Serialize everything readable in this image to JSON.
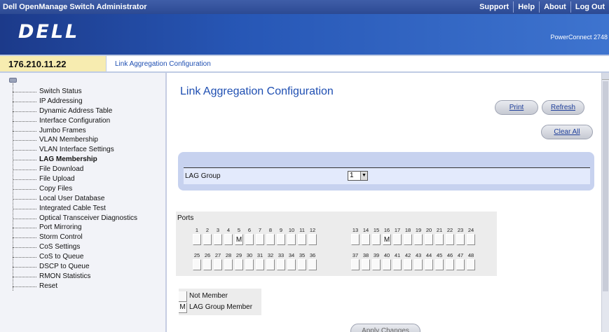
{
  "topbar": {
    "title": "Dell OpenManage Switch Administrator",
    "links": [
      "Support",
      "Help",
      "About",
      "Log Out"
    ]
  },
  "banner": {
    "logo": "DELL",
    "product": "PowerConnect 2748"
  },
  "address": {
    "ip": "176.210.11.22",
    "breadcrumb": "Link Aggregation Configuration"
  },
  "sidebar": {
    "items": [
      {
        "label": "Switch Status"
      },
      {
        "label": "IP Addressing"
      },
      {
        "label": "Dynamic Address Table"
      },
      {
        "label": "Interface Configuration"
      },
      {
        "label": "Jumbo Frames"
      },
      {
        "label": "VLAN Membership"
      },
      {
        "label": "VLAN Interface Settings"
      },
      {
        "label": "LAG Membership",
        "active": true
      },
      {
        "label": "File Download"
      },
      {
        "label": "File Upload"
      },
      {
        "label": "Copy Files"
      },
      {
        "label": "Local User Database"
      },
      {
        "label": "Integrated Cable Test"
      },
      {
        "label": "Optical Transceiver Diagnostics"
      },
      {
        "label": "Port Mirroring"
      },
      {
        "label": "Storm Control"
      },
      {
        "label": "CoS Settings"
      },
      {
        "label": "CoS to Queue"
      },
      {
        "label": "DSCP to Queue"
      },
      {
        "label": "RMON Statistics"
      },
      {
        "label": "Reset"
      }
    ]
  },
  "main": {
    "title": "Link Aggregation Configuration",
    "buttons": {
      "print": "Print",
      "refresh": "Refresh",
      "clear_all": "Clear All",
      "apply": "Apply Changes"
    },
    "lag_group": {
      "label": "LAG Group",
      "value": "1"
    },
    "ports": {
      "label": "Ports",
      "groups": [
        {
          "numbers": [
            "1",
            "2",
            "3",
            "4",
            "5",
            "6",
            "7",
            "8",
            "9",
            "10",
            "11",
            "12"
          ],
          "members": [
            "",
            "",
            "",
            "",
            "M",
            "",
            "",
            "",
            "",
            "",
            "",
            ""
          ]
        },
        {
          "numbers": [
            "13",
            "14",
            "15",
            "16",
            "17",
            "18",
            "19",
            "20",
            "21",
            "22",
            "23",
            "24"
          ],
          "members": [
            "",
            "",
            "",
            "M",
            "",
            "",
            "",
            "",
            "",
            "",
            "",
            ""
          ]
        },
        {
          "numbers": [
            "25",
            "26",
            "27",
            "28",
            "29",
            "30",
            "31",
            "32",
            "33",
            "34",
            "35",
            "36"
          ],
          "members": [
            "",
            "",
            "",
            "",
            "",
            "",
            "",
            "",
            "",
            "",
            "",
            ""
          ]
        },
        {
          "numbers": [
            "37",
            "38",
            "39",
            "40",
            "41",
            "42",
            "43",
            "44",
            "45",
            "46",
            "47",
            "48"
          ],
          "members": [
            "",
            "",
            "",
            "",
            "",
            "",
            "",
            "",
            "",
            "",
            "",
            ""
          ]
        }
      ]
    },
    "legend": [
      {
        "symbol": "",
        "text": "Not Member"
      },
      {
        "symbol": "M",
        "text": "LAG Group Member"
      }
    ]
  }
}
